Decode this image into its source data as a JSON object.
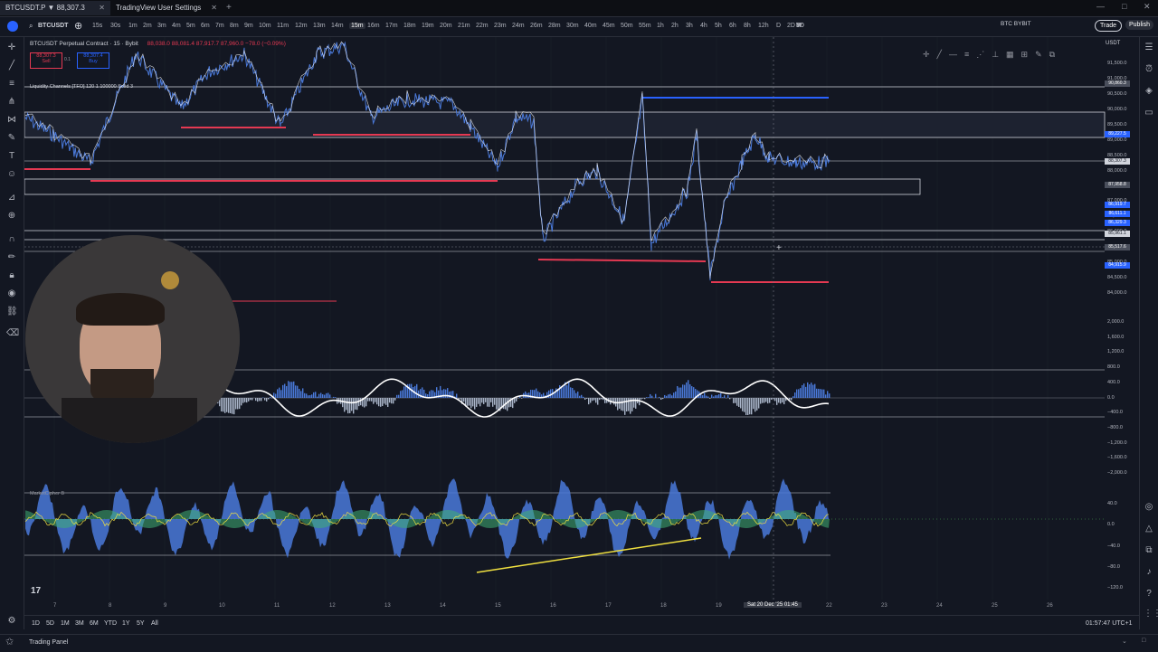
{
  "browser": {
    "tabs": [
      {
        "label": "BTCUSDT.P ▼ 88,307.3 −0.09%"
      },
      {
        "label": "TradingView User Settings"
      }
    ],
    "close_glyph": "✕",
    "new_tab_glyph": "+"
  },
  "toolbar": {
    "symbol": "BTCUSDT",
    "timeframes": [
      "15s",
      "30s",
      "1m",
      "2m",
      "3m",
      "4m",
      "5m",
      "6m",
      "7m",
      "8m",
      "9m",
      "10m",
      "11m",
      "12m",
      "13m",
      "14m",
      "15m",
      "16m",
      "17m",
      "18m",
      "19m",
      "20m",
      "21m",
      "22m",
      "23m",
      "24m",
      "26m",
      "28m",
      "30m",
      "40m",
      "45m",
      "50m",
      "55m",
      "1h",
      "2h",
      "3h",
      "4h",
      "5h",
      "6h",
      "8h",
      "12h",
      "D",
      "2D",
      "3D",
      "5D",
      "W",
      "M"
    ],
    "active_timeframe": "15m",
    "exchange_label": "BTC BYBIT",
    "trade_label": "Trade",
    "publish_label": "Publish"
  },
  "legend": {
    "instrument": "BTCUSDT Perpetual Contract · 15 · Bybit",
    "ohlc": "88,038.0 88,081.4 87,917.7 87,960.0 −78.0 (−0.09%)",
    "sell_price": "88,307.3",
    "sell_label": "Sell",
    "spread": "0.1",
    "buy_price": "88,307.4",
    "buy_label": "Buy",
    "indicator1": "Liquidity Channels [TFO] 120 1 100000 Solid 3",
    "indicator2": "MarketCipher B"
  },
  "price_axis": {
    "currency": "USDT",
    "labels": [
      "91,500.0",
      "91,000.0",
      "90,500.0",
      "90,000.0",
      "89,500.0",
      "89,000.0",
      "88,500.0",
      "88,000.0",
      "87,500.0",
      "87,000.0",
      "86,500.0",
      "86,000.0",
      "85,500.0",
      "85,000.0",
      "84,500.0",
      "84,000.0"
    ],
    "badges": [
      {
        "text": "90,860.3",
        "color": "#4a4f5c"
      },
      {
        "text": "89,227.5",
        "color": "#2962ff"
      },
      {
        "text": "88,307.3",
        "color": "#d1d4dc"
      },
      {
        "text": "87,958.8",
        "color": "#4a4f5c"
      },
      {
        "text": "86,919.7",
        "color": "#2962ff"
      },
      {
        "text": "86,611.1",
        "color": "#2962ff"
      },
      {
        "text": "86,329.3",
        "color": "#2962ff"
      },
      {
        "text": "85,961.1",
        "color": "#d1d4dc"
      },
      {
        "text": "85,517.6",
        "color": "#4a4f5c"
      },
      {
        "text": "84,915.9",
        "color": "#2962ff"
      }
    ]
  },
  "osc1_axis": {
    "labels": [
      "2,000.0",
      "1,600.0",
      "1,200.0",
      "800.0",
      "400.0",
      "0.0",
      "−400.0",
      "−800.0",
      "−1,200.0",
      "−1,600.0",
      "−2,000.0"
    ]
  },
  "osc2_axis": {
    "labels": [
      "40.0",
      "0.0",
      "−40.0",
      "−80.0",
      "−120.0"
    ]
  },
  "time_axis": {
    "labels": [
      "7",
      "8",
      "9",
      "10",
      "11",
      "12",
      "13",
      "14",
      "15",
      "16",
      "17",
      "18",
      "19",
      "21",
      "22",
      "23",
      "24",
      "25",
      "26"
    ],
    "crosshair": "Sat 20 Dec '25  01:45"
  },
  "range_bar": {
    "ranges": [
      "1D",
      "5D",
      "1M",
      "3M",
      "6M",
      "YTD",
      "1Y",
      "5Y",
      "All"
    ],
    "clock": "01:57:47 UTC+1"
  },
  "bottom": {
    "panel_label": "Trading Panel"
  },
  "colors": {
    "background": "#131722",
    "up_line": "#4a79d9",
    "red_level": "#e53952",
    "blue_level": "#2962ff",
    "cipher_yellow": "#f0e040"
  },
  "icons": [
    "menu-icon",
    "cursor-icon",
    "trendline-icon",
    "fib-icon",
    "pattern-icon",
    "brush-icon",
    "text-icon",
    "emoji-icon",
    "ruler-icon",
    "zoom-icon",
    "magnet-icon",
    "lock-icon",
    "eye-icon",
    "trash-icon"
  ]
}
